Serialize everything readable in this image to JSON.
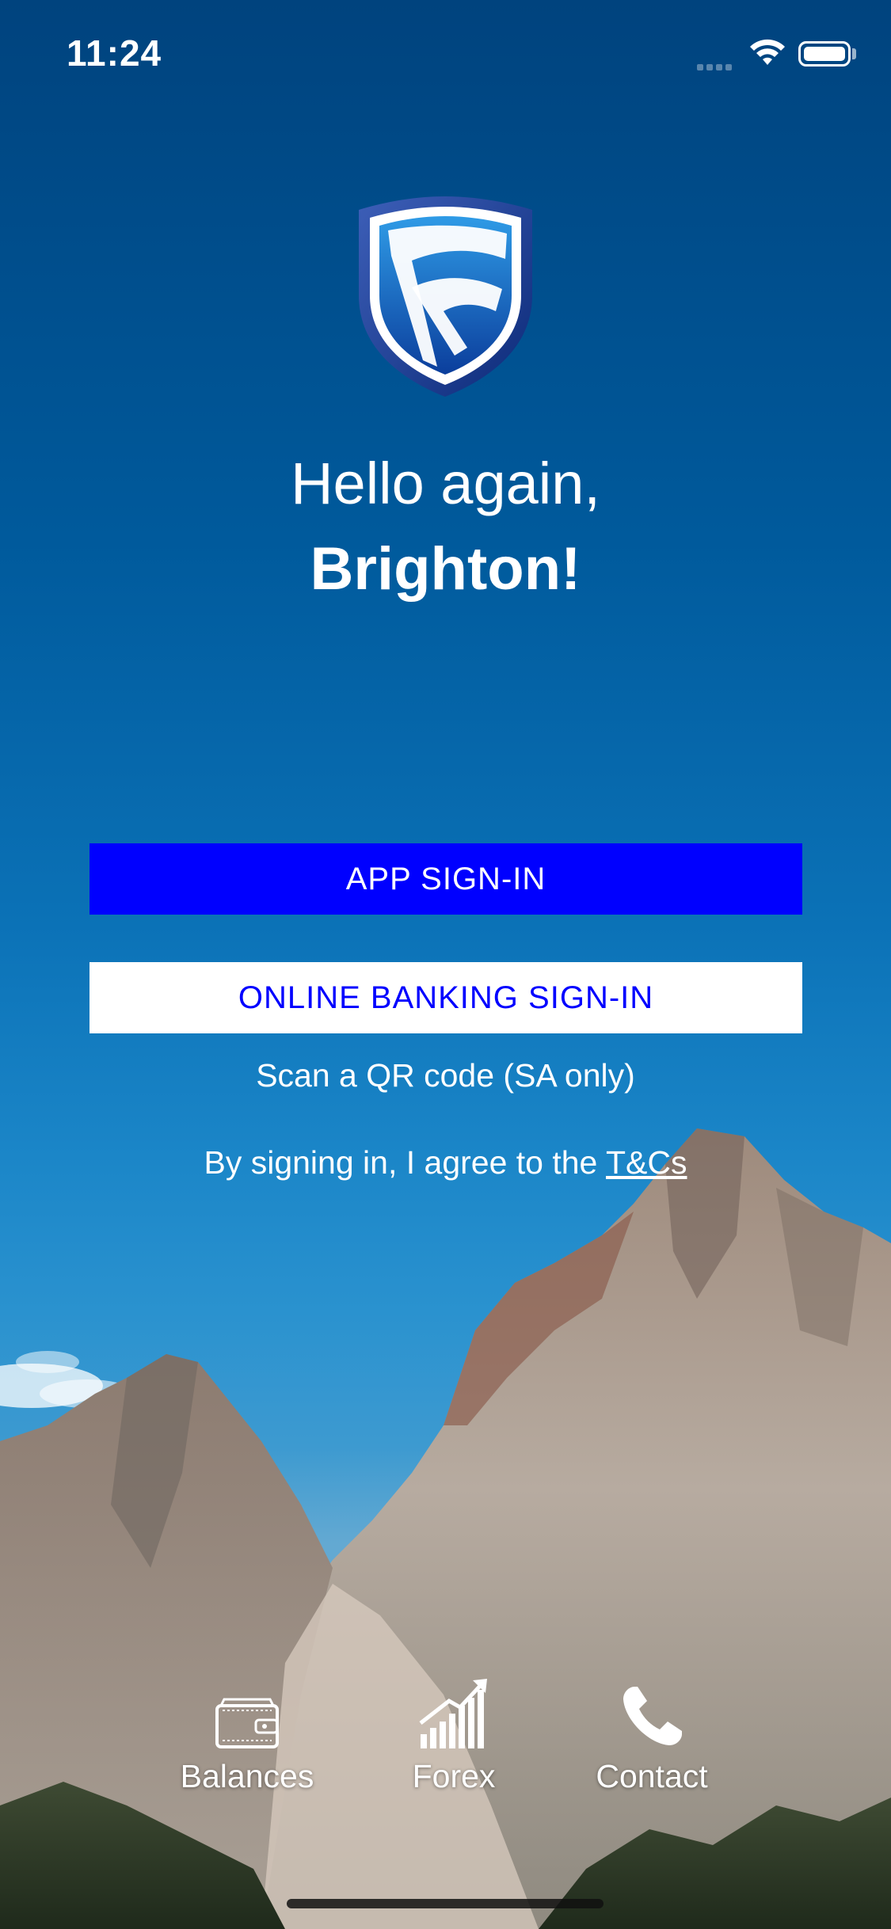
{
  "status_bar": {
    "time": "11:24",
    "icons": [
      "cellular-signal-icon",
      "wifi-icon",
      "battery-icon"
    ]
  },
  "logo": {
    "name": "standard-bank-shield-logo"
  },
  "greeting": {
    "line1": "Hello again,",
    "line2": "Brighton!"
  },
  "buttons": {
    "app_signin": "APP SIGN-IN",
    "online_banking_signin": "ONLINE BANKING SIGN-IN"
  },
  "links": {
    "qr_code": "Scan a QR code (SA only)",
    "terms_prefix": "By signing in, I agree to the ",
    "terms_link": "T&Cs"
  },
  "bottom_nav": [
    {
      "label": "Balances",
      "icon": "wallet-icon"
    },
    {
      "label": "Forex",
      "icon": "chart-growth-icon"
    },
    {
      "label": "Contact",
      "icon": "phone-icon"
    }
  ],
  "colors": {
    "primary_button": "#0000ff",
    "background_top": "#00437e",
    "button_text_secondary": "#0000ff"
  }
}
